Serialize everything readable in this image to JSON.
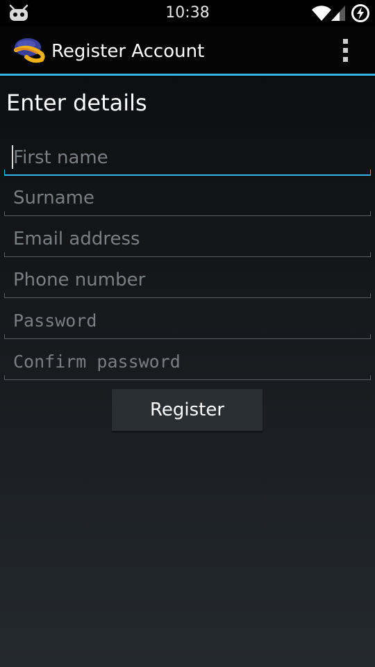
{
  "status_bar": {
    "time": "10:38",
    "icons": [
      "robot-notification-icon",
      "wifi-icon",
      "signal-icon",
      "battery-charging-icon"
    ]
  },
  "action_bar": {
    "title": "Register Account",
    "app_icon": "app-logo-icon",
    "overflow_icon": "overflow-menu-icon"
  },
  "form": {
    "heading": "Enter details",
    "fields": [
      {
        "placeholder": "First name",
        "value": "",
        "focused": true
      },
      {
        "placeholder": "Surname",
        "value": ""
      },
      {
        "placeholder": "Email address",
        "value": ""
      },
      {
        "placeholder": "Phone number",
        "value": ""
      },
      {
        "placeholder": "Password",
        "value": ""
      },
      {
        "placeholder": "Confirm password",
        "value": ""
      }
    ],
    "submit_label": "Register"
  },
  "colors": {
    "accent": "#33b5e5",
    "placeholder": "#7a7f84",
    "action_bar": "#050505"
  }
}
